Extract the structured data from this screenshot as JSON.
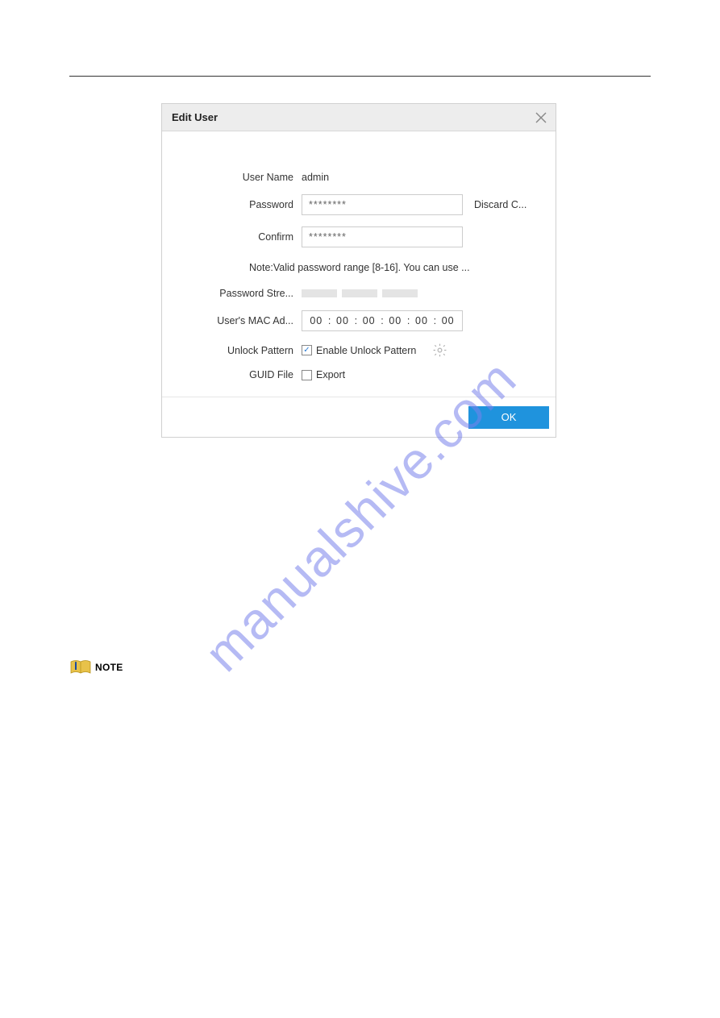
{
  "modal": {
    "title": "Edit User",
    "fields": {
      "user_name_label": "User Name",
      "user_name_value": "admin",
      "password_label": "Password",
      "password_value": "********",
      "discard_label": "Discard C...",
      "confirm_label": "Confirm",
      "confirm_value": "********",
      "note_text": "Note:Valid password range [8-16]. You can use ...",
      "strength_label": "Password Stre...",
      "mac_label": "User's MAC Ad...",
      "mac_segments": [
        "00",
        "00",
        "00",
        "00",
        "00",
        "00"
      ],
      "unlock_label": "Unlock Pattern",
      "unlock_check_label": "Enable Unlock Pattern",
      "unlock_checked": true,
      "guid_label": "GUID File",
      "guid_check_label": "Export",
      "guid_checked": false
    },
    "ok_label": "OK"
  },
  "note_callout": "NOTE",
  "watermark": "manualshive.com"
}
